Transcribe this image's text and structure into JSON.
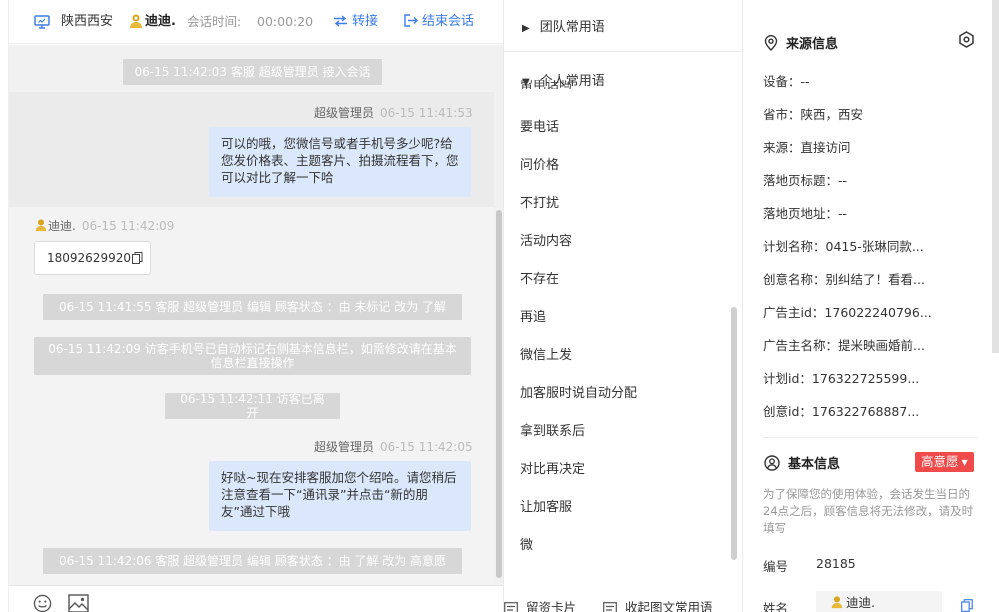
{
  "header": {
    "location": "陕西西安",
    "customer_name": "迪迪.",
    "session_time_label": "会话时间:",
    "session_time": "00:00:20",
    "transfer_label": "转接",
    "end_label": "结束会话"
  },
  "messages": {
    "sys1": "06-15 11:42:03 客服 超级管理员 接入会话",
    "agent1_name": "超级管理员",
    "agent1_time": "06-15 11:41:53",
    "agent1_text": "可以的哦，您微信号或者手机号多少呢?给您发价格表、主题客片、拍摄流程看下，您可以对比了解一下哈",
    "visitor_name": "迪迪.",
    "visitor_time": "06-15 11:42:09",
    "visitor_phone": "18092629920",
    "sys2": "06-15 11:41:55 客服 超级管理员 编辑 顾客状态 ：由 未标记 改为 了解",
    "sys3": "06-15 11:42:09 访客手机号已自动标记右侧基本信息栏，如需修改请在基本信息栏直接操作",
    "sys4": "06-15 11:42:11 访客已离开",
    "agent2_name": "超级管理员",
    "agent2_time": "06-15 11:42:05",
    "agent2_text": "好哒~现在安排客服加您个绍哈。请您稍后注意查看一下“通讯录”并点击“新的朋友”通过下哦",
    "sys5": "06-15 11:42:06 客服 超级管理员 编辑 顾客状态 ：由 了解 改为 高意愿"
  },
  "phrases": {
    "team_group": "团队常用语",
    "personal_group": "个人常用语",
    "clipped_item": "留电话吗",
    "items": [
      "要电话",
      "问价格",
      "不打扰",
      "活动内容",
      "不存在",
      "再追",
      "微信上发",
      "加客服时说自动分配",
      "拿到联系后",
      "对比再决定",
      "让加客服",
      "微"
    ],
    "footer_card": "留资卡片",
    "footer_collect": "收起图文常用语"
  },
  "info": {
    "source_title": "来源信息",
    "device": "设备：--",
    "province": "省市：陕西，西安",
    "source": "来源：直接访问",
    "landing_title": "落地页标题：--",
    "landing_url": "落地页地址：--",
    "plan_name": "计划名称：0415-张琳同款...",
    "creative_name": "创意名称：别纠结了！看看...",
    "advertiser_id": "广告主id：176022240796...",
    "advertiser_name": "广告主名称：提米映画婚前...",
    "plan_id": "计划id：176322725599...",
    "creative_id": "创意id：176322768887...",
    "basic_title": "基本信息",
    "intent_badge": "高意愿",
    "notice": "为了保障您的使用体验，会话发生当日的24点之后，顾客信息将无法修改，请及时填写",
    "number_label": "编号",
    "number_value": "28185",
    "name_label": "姓名",
    "name_value": "迪迪."
  },
  "colors": {
    "accent": "#3b7de9",
    "badge": "#f04a4a",
    "bubble": "#dbe8fb",
    "system_pill": "#d7d7d7"
  },
  "icons": [
    "monitor-icon",
    "avatar-icon",
    "transfer-icon",
    "end-session-icon",
    "copy-icon",
    "emoji-icon",
    "image-icon",
    "location-pin-icon",
    "settings-icon",
    "user-circle-icon",
    "card-icon"
  ]
}
